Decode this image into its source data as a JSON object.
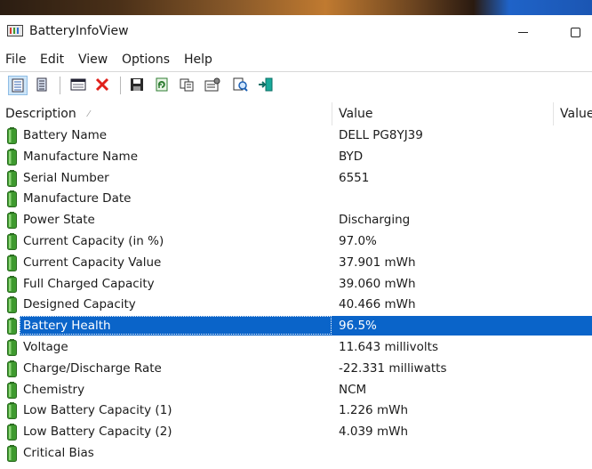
{
  "window": {
    "title": "BatteryInfoView"
  },
  "menu": [
    "File",
    "Edit",
    "View",
    "Options",
    "Help"
  ],
  "toolbar": {
    "icons": [
      "view-list-icon",
      "view-report-icon",
      "properties-window-icon",
      "delete-icon",
      "save-icon",
      "refresh-icon",
      "copy-icon",
      "properties-icon",
      "find-icon",
      "exit-icon"
    ]
  },
  "list": {
    "columns": [
      "Description",
      "Value",
      "Value"
    ],
    "selected_row": "Battery Health",
    "rows": [
      {
        "description": "Battery Name",
        "value": "DELL PG8YJ39"
      },
      {
        "description": "Manufacture Name",
        "value": "BYD"
      },
      {
        "description": "Serial Number",
        "value": "6551"
      },
      {
        "description": "Manufacture Date",
        "value": ""
      },
      {
        "description": "Power State",
        "value": "Discharging"
      },
      {
        "description": "Current Capacity (in %)",
        "value": "97.0%"
      },
      {
        "description": "Current Capacity Value",
        "value": "37.901 mWh"
      },
      {
        "description": "Full Charged Capacity",
        "value": "39.060 mWh"
      },
      {
        "description": "Designed Capacity",
        "value": "40.466 mWh"
      },
      {
        "description": "Battery Health",
        "value": "96.5%"
      },
      {
        "description": "Voltage",
        "value": "11.643 millivolts"
      },
      {
        "description": "Charge/Discharge Rate",
        "value": "-22.331 milliwatts"
      },
      {
        "description": "Chemistry",
        "value": "NCM"
      },
      {
        "description": "Low Battery Capacity (1)",
        "value": "1.226 mWh"
      },
      {
        "description": "Low Battery Capacity (2)",
        "value": "4.039 mWh"
      },
      {
        "description": "Critical Bias",
        "value": ""
      }
    ]
  },
  "colors": {
    "selection": "#0a64c9",
    "battery_green": "#3f9a2f",
    "accent": "#1f63c8"
  }
}
